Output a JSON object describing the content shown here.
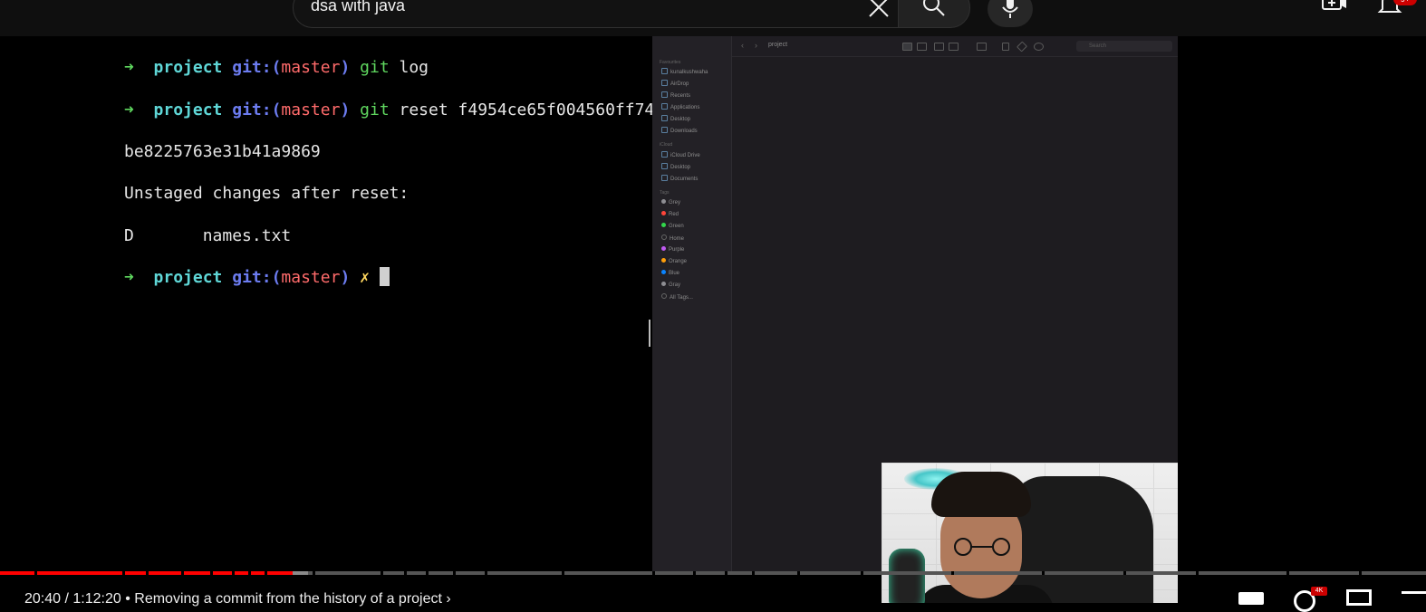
{
  "header": {
    "search_query": "dsa with java",
    "notification_badge": "9+",
    "icons": [
      "clear-icon",
      "search-icon",
      "mic-icon",
      "create-icon",
      "bell-icon"
    ]
  },
  "terminal": {
    "lines": [
      {
        "arrow": "➜",
        "dir": "project",
        "git": "git:(",
        "branch": "master",
        "git_close": ")",
        "dirty": "",
        "cmd_git": "git",
        "cmd_rest": " log"
      },
      {
        "arrow": "➜",
        "dir": "project",
        "git": "git:(",
        "branch": "master",
        "git_close": ")",
        "dirty": "",
        "cmd_git": "git",
        "cmd_rest": " reset f4954ce65f004560ff74"
      }
    ],
    "output": [
      "be8225763e31b41a9869",
      "Unstaged changes after reset:",
      "D       names.txt"
    ],
    "prompt": {
      "arrow": "➜",
      "dir": "project",
      "git": "git:(",
      "branch": "master",
      "git_close": ")",
      "dirty": "✗"
    }
  },
  "finder": {
    "title": "project",
    "search_placeholder": "Search",
    "favourites_header": "Favourites",
    "favourites": [
      "kunalkushwaha",
      "AirDrop",
      "Recents",
      "Applications",
      "Desktop",
      "Downloads"
    ],
    "icloud_header": "iCloud",
    "icloud": [
      "iCloud Drive",
      "Desktop",
      "Documents"
    ],
    "tags_header": "Tags",
    "tags": [
      {
        "name": "Grey",
        "color": "#8e8e93"
      },
      {
        "name": "Red",
        "color": "#ff453a"
      },
      {
        "name": "Green",
        "color": "#32d74b"
      },
      {
        "name": "Home",
        "color": "#555555"
      },
      {
        "name": "Purple",
        "color": "#bf5af2"
      },
      {
        "name": "Orange",
        "color": "#ff9f0a"
      },
      {
        "name": "Blue",
        "color": "#0a84ff"
      },
      {
        "name": "Gray",
        "color": "#8e8e93"
      },
      {
        "name": "All Tags...",
        "color": ""
      }
    ]
  },
  "player": {
    "progress_fraction": 0.205,
    "buffered_fraction": 0.216,
    "time_display": "20:40 / 1:12:20",
    "chapter_title": "• Removing a commit from the history of a project",
    "quality_badge": "4K",
    "played_color": "#ff0000"
  }
}
